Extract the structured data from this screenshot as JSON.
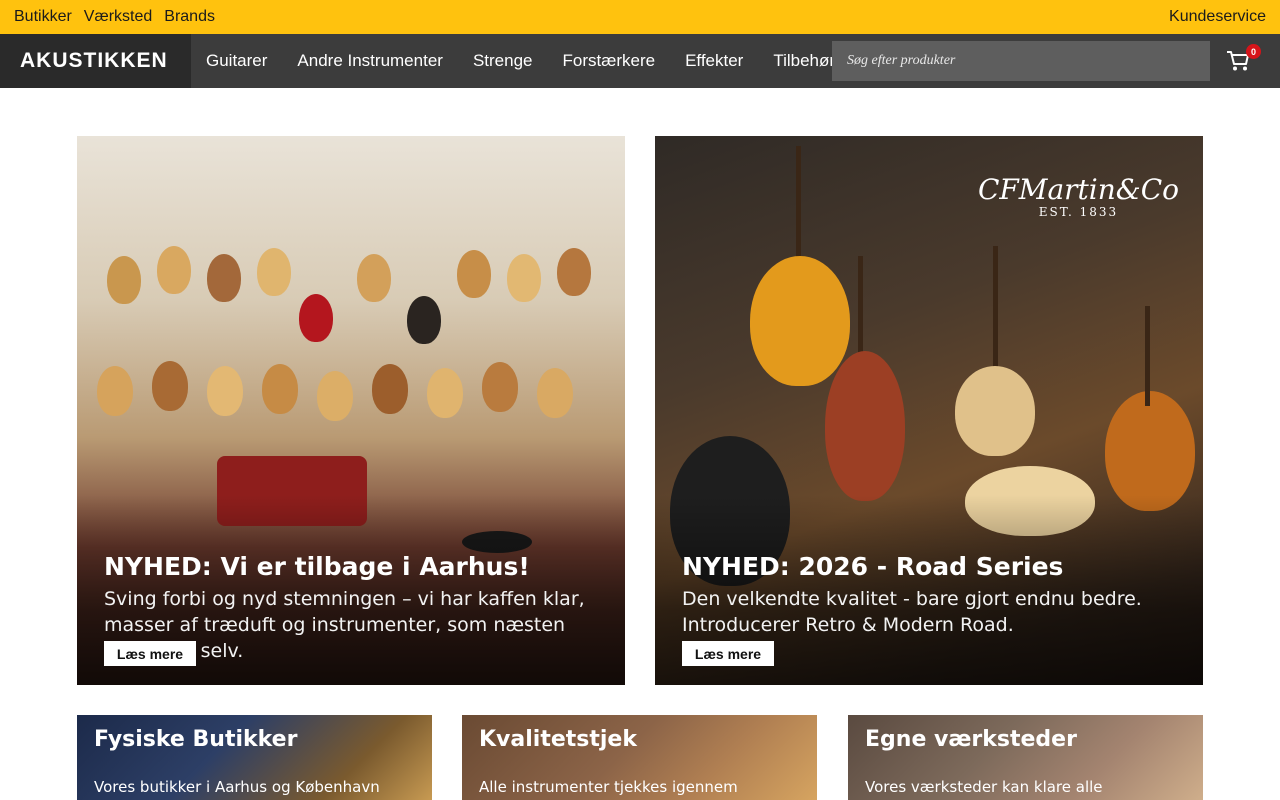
{
  "topbar": {
    "links": [
      "Butikker",
      "Værksted",
      "Brands"
    ],
    "customer_service": "Kundeservice"
  },
  "header": {
    "logo": "AKUSTIKKEN",
    "menu": [
      "Guitarer",
      "Andre Instrumenter",
      "Strenge",
      "Forstærkere",
      "Effekter",
      "Tilbehør"
    ],
    "search_placeholder": "Søg efter produkter",
    "cart_count": "0"
  },
  "banners": [
    {
      "title": "NYHED: Vi er tilbage i Aarhus!",
      "text": "Sving forbi og nyd stemningen – vi har kaffen klar, masser af træduft og instrumenter, som næsten spiller sig selv.",
      "button": "Læs mere"
    },
    {
      "title": "NYHED: 2026 - Road Series",
      "text": "Den velkendte kvalitet - bare gjort endnu bedre. Introducerer Retro & Modern Road.",
      "button": "Læs mere",
      "brand_logo": "CFMartin&Co",
      "brand_est": "EST. 1833"
    }
  ],
  "cards": [
    {
      "title": "Fysiske Butikker",
      "text": "Vores butikker i Aarhus og København"
    },
    {
      "title": "Kvalitetstjek",
      "text": "Alle instrumenter tjekkes igennem"
    },
    {
      "title": "Egne værksteder",
      "text": "Vores værksteder kan klare alle"
    }
  ]
}
